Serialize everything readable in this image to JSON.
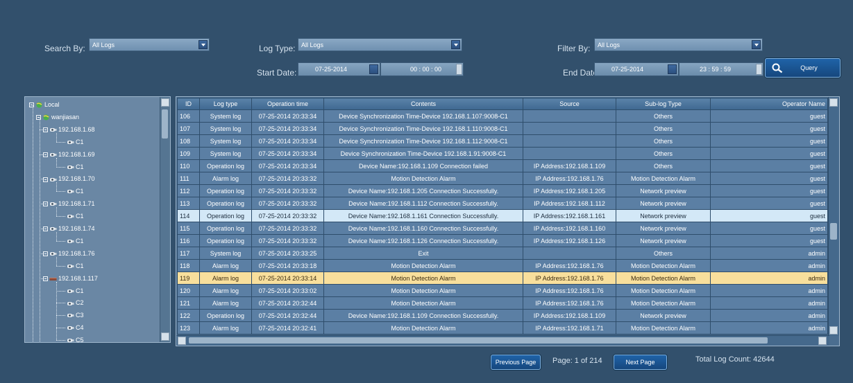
{
  "filters": {
    "search_by_label": "Search By:",
    "search_by_value": "All Logs",
    "log_type_label": "Log Type:",
    "log_type_value": "All Logs",
    "filter_by_label": "Filter By:",
    "filter_by_value": "All Logs",
    "start_date_label": "Start Date:",
    "start_date": "07-25-2014",
    "start_time": "00 : 00 : 00",
    "end_date_label": "End Date:",
    "end_date": "07-25-2014",
    "end_time": "23 : 59 : 59",
    "query_label": "Query"
  },
  "tree": {
    "root": "Local",
    "group": "wanjiasan",
    "devices": [
      {
        "name": "192.168.1.68",
        "channels": [
          "C1"
        ]
      },
      {
        "name": "192.168.1.69",
        "channels": [
          "C1"
        ]
      },
      {
        "name": "192.168.1.70",
        "channels": [
          "C1"
        ]
      },
      {
        "name": "192.168.1.71",
        "channels": [
          "C1"
        ]
      },
      {
        "name": "192.168.1.74",
        "channels": [
          "C1"
        ]
      },
      {
        "name": "192.168.1.76",
        "channels": [
          "C1"
        ]
      },
      {
        "name": "192.168.1.117",
        "channels": [
          "C1",
          "C2",
          "C3",
          "C4",
          "C5"
        ]
      }
    ]
  },
  "table": {
    "columns": [
      "ID",
      "Log type",
      "Operation time",
      "Contents",
      "Source",
      "Sub-log Type",
      "Operator Name"
    ],
    "selected_id": "114",
    "highlighted_id": "119",
    "rows": [
      [
        "106",
        "System log",
        "07-25-2014 20:33:34",
        "Device Synchronization Time-Device 192.168.1.107:9008-C1",
        "",
        "Others",
        "guest"
      ],
      [
        "107",
        "System log",
        "07-25-2014 20:33:34",
        "Device Synchronization Time-Device 192.168.1.110:9008-C1",
        "",
        "Others",
        "guest"
      ],
      [
        "108",
        "System log",
        "07-25-2014 20:33:34",
        "Device Synchronization Time-Device 192.168.1.112:9008-C1",
        "",
        "Others",
        "guest"
      ],
      [
        "109",
        "System log",
        "07-25-2014 20:33:34",
        "Device Synchronization Time-Device 192.168.1.91:9008-C1",
        "",
        "Others",
        "guest"
      ],
      [
        "110",
        "Operation log",
        "07-25-2014 20:33:34",
        "Device Name:192.168.1.109 Connection failed",
        "IP Address:192.168.1.109",
        "Others",
        "guest"
      ],
      [
        "111",
        "Alarm log",
        "07-25-2014 20:33:32",
        "Motion Detection Alarm",
        "IP Address:192.168.1.76",
        "Motion Detection Alarm",
        "guest"
      ],
      [
        "112",
        "Operation log",
        "07-25-2014 20:33:32",
        "Device Name:192.168.1.205 Connection Successfully.",
        "IP Address:192.168.1.205",
        "Network preview",
        "guest"
      ],
      [
        "113",
        "Operation log",
        "07-25-2014 20:33:32",
        "Device Name:192.168.1.112 Connection Successfully.",
        "IP Address:192.168.1.112",
        "Network preview",
        "guest"
      ],
      [
        "114",
        "Operation log",
        "07-25-2014 20:33:32",
        "Device Name:192.168.1.161 Connection Successfully.",
        "IP Address:192.168.1.161",
        "Network preview",
        "guest"
      ],
      [
        "115",
        "Operation log",
        "07-25-2014 20:33:32",
        "Device Name:192.168.1.160 Connection Successfully.",
        "IP Address:192.168.1.160",
        "Network preview",
        "guest"
      ],
      [
        "116",
        "Operation log",
        "07-25-2014 20:33:32",
        "Device Name:192.168.1.126 Connection Successfully.",
        "IP Address:192.168.1.126",
        "Network preview",
        "guest"
      ],
      [
        "117",
        "System log",
        "07-25-2014 20:33:25",
        "Exit",
        "",
        "Others",
        "admin"
      ],
      [
        "118",
        "Alarm log",
        "07-25-2014 20:33:18",
        "Motion Detection Alarm",
        "IP Address:192.168.1.76",
        "Motion Detection Alarm",
        "admin"
      ],
      [
        "119",
        "Alarm log",
        "07-25-2014 20:33:14",
        "Motion Detection Alarm",
        "IP Address:192.168.1.76",
        "Motion Detection Alarm",
        "admin"
      ],
      [
        "120",
        "Alarm log",
        "07-25-2014 20:33:02",
        "Motion Detection Alarm",
        "IP Address:192.168.1.76",
        "Motion Detection Alarm",
        "admin"
      ],
      [
        "121",
        "Alarm log",
        "07-25-2014 20:32:44",
        "Motion Detection Alarm",
        "IP Address:192.168.1.76",
        "Motion Detection Alarm",
        "admin"
      ],
      [
        "122",
        "Operation log",
        "07-25-2014 20:32:44",
        "Device Name:192.168.1.109 Connection Successfully.",
        "IP Address:192.168.1.109",
        "Network preview",
        "admin"
      ],
      [
        "123",
        "Alarm log",
        "07-25-2014 20:32:41",
        "Motion Detection Alarm",
        "IP Address:192.168.1.71",
        "Motion Detection Alarm",
        "admin"
      ]
    ]
  },
  "pagination": {
    "prev_label": "Previous Page",
    "page_text": "Page: 1 of 214",
    "next_label": "Next Page",
    "total_text": "Total Log Count:  42644"
  },
  "colors": {
    "background": "#32506c",
    "row": "#5b7fa4",
    "selected_row": "#d3e8f7",
    "highlighted_row": "#f8df9c",
    "button": "#1f63a8"
  },
  "icons": {
    "query": "magnifier-icon",
    "camera": "camera-icon",
    "dvr": "dvr-icon",
    "globe": "globe-icon"
  }
}
